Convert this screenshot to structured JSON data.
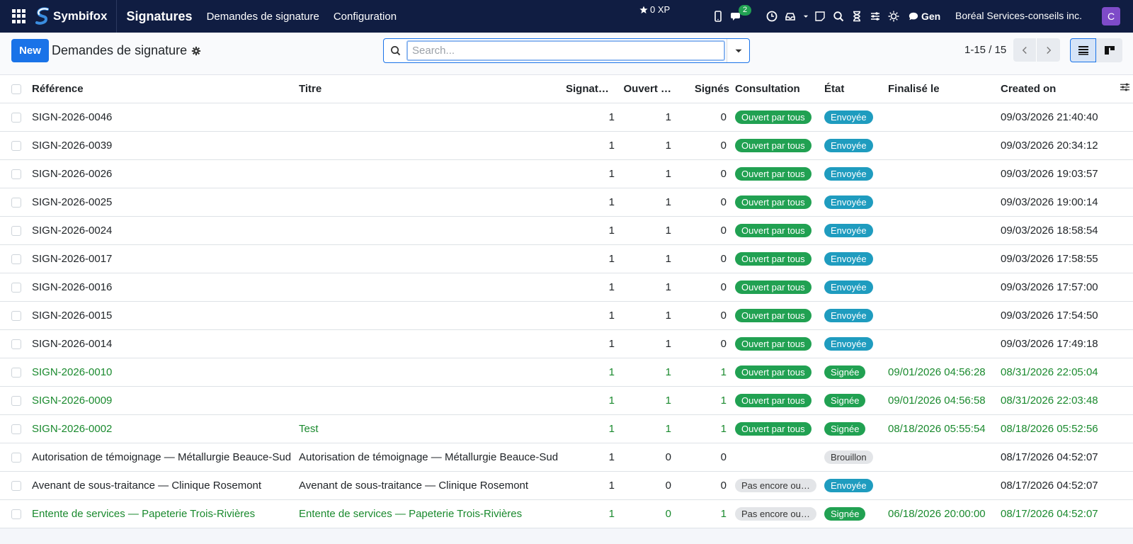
{
  "navbar": {
    "brand": "Symbifox",
    "app_title": "Signatures",
    "menu": [
      "Demandes de signature",
      "Configuration"
    ],
    "xp": "0 XP",
    "messages_count": "2",
    "gen_label": "Gen",
    "company": "Boréal Services-conseils inc.",
    "avatar_letter": "C"
  },
  "control": {
    "new_label": "New",
    "breadcrumb": "Demandes de signature",
    "search_placeholder": "Search...",
    "pager": "1-15 / 15"
  },
  "table": {
    "headers": {
      "reference": "Référence",
      "titre": "Titre",
      "signataires": "Signatai…",
      "ouvert": "Ouvert …",
      "signes": "Signés",
      "consultation": "Consultation",
      "etat": "État",
      "finalise": "Finalisé le",
      "created": "Created on"
    },
    "rows": [
      {
        "ref": "SIGN-2026-0046",
        "titre": "",
        "sig": "1",
        "ouv": "1",
        "signes": "0",
        "consultation": "Ouvert par tous",
        "cons_color": "green",
        "etat": "Envoyée",
        "etat_color": "teal",
        "finalise": "",
        "created": "09/03/2026 21:40:40",
        "done": false
      },
      {
        "ref": "SIGN-2026-0039",
        "titre": "",
        "sig": "1",
        "ouv": "1",
        "signes": "0",
        "consultation": "Ouvert par tous",
        "cons_color": "green",
        "etat": "Envoyée",
        "etat_color": "teal",
        "finalise": "",
        "created": "09/03/2026 20:34:12",
        "done": false
      },
      {
        "ref": "SIGN-2026-0026",
        "titre": "",
        "sig": "1",
        "ouv": "1",
        "signes": "0",
        "consultation": "Ouvert par tous",
        "cons_color": "green",
        "etat": "Envoyée",
        "etat_color": "teal",
        "finalise": "",
        "created": "09/03/2026 19:03:57",
        "done": false
      },
      {
        "ref": "SIGN-2026-0025",
        "titre": "",
        "sig": "1",
        "ouv": "1",
        "signes": "0",
        "consultation": "Ouvert par tous",
        "cons_color": "green",
        "etat": "Envoyée",
        "etat_color": "teal",
        "finalise": "",
        "created": "09/03/2026 19:00:14",
        "done": false
      },
      {
        "ref": "SIGN-2026-0024",
        "titre": "",
        "sig": "1",
        "ouv": "1",
        "signes": "0",
        "consultation": "Ouvert par tous",
        "cons_color": "green",
        "etat": "Envoyée",
        "etat_color": "teal",
        "finalise": "",
        "created": "09/03/2026 18:58:54",
        "done": false
      },
      {
        "ref": "SIGN-2026-0017",
        "titre": "",
        "sig": "1",
        "ouv": "1",
        "signes": "0",
        "consultation": "Ouvert par tous",
        "cons_color": "green",
        "etat": "Envoyée",
        "etat_color": "teal",
        "finalise": "",
        "created": "09/03/2026 17:58:55",
        "done": false
      },
      {
        "ref": "SIGN-2026-0016",
        "titre": "",
        "sig": "1",
        "ouv": "1",
        "signes": "0",
        "consultation": "Ouvert par tous",
        "cons_color": "green",
        "etat": "Envoyée",
        "etat_color": "teal",
        "finalise": "",
        "created": "09/03/2026 17:57:00",
        "done": false
      },
      {
        "ref": "SIGN-2026-0015",
        "titre": "",
        "sig": "1",
        "ouv": "1",
        "signes": "0",
        "consultation": "Ouvert par tous",
        "cons_color": "green",
        "etat": "Envoyée",
        "etat_color": "teal",
        "finalise": "",
        "created": "09/03/2026 17:54:50",
        "done": false
      },
      {
        "ref": "SIGN-2026-0014",
        "titre": "",
        "sig": "1",
        "ouv": "1",
        "signes": "0",
        "consultation": "Ouvert par tous",
        "cons_color": "green",
        "etat": "Envoyée",
        "etat_color": "teal",
        "finalise": "",
        "created": "09/03/2026 17:49:18",
        "done": false
      },
      {
        "ref": "SIGN-2026-0010",
        "titre": "",
        "sig": "1",
        "ouv": "1",
        "signes": "1",
        "consultation": "Ouvert par tous",
        "cons_color": "green",
        "etat": "Signée",
        "etat_color": "green",
        "finalise": "09/01/2026 04:56:28",
        "created": "08/31/2026 22:05:04",
        "done": true
      },
      {
        "ref": "SIGN-2026-0009",
        "titre": "",
        "sig": "1",
        "ouv": "1",
        "signes": "1",
        "consultation": "Ouvert par tous",
        "cons_color": "green",
        "etat": "Signée",
        "etat_color": "green",
        "finalise": "09/01/2026 04:56:58",
        "created": "08/31/2026 22:03:48",
        "done": true
      },
      {
        "ref": "SIGN-2026-0002",
        "titre": "Test",
        "sig": "1",
        "ouv": "1",
        "signes": "1",
        "consultation": "Ouvert par tous",
        "cons_color": "green",
        "etat": "Signée",
        "etat_color": "green",
        "finalise": "08/18/2026 05:55:54",
        "created": "08/18/2026 05:52:56",
        "done": true
      },
      {
        "ref": "Autorisation de témoignage — Métallurgie Beauce-Sud",
        "titre": "Autorisation de témoignage — Métallurgie Beauce-Sud",
        "sig": "1",
        "ouv": "0",
        "signes": "0",
        "consultation": "",
        "cons_color": "",
        "etat": "Brouillon",
        "etat_color": "grey",
        "finalise": "",
        "created": "08/17/2026 04:52:07",
        "done": false
      },
      {
        "ref": "Avenant de sous-traitance — Clinique Rosemont",
        "titre": "Avenant de sous-traitance — Clinique Rosemont",
        "sig": "1",
        "ouv": "0",
        "signes": "0",
        "consultation": "Pas encore ouvert",
        "cons_color": "grey",
        "etat": "Envoyée",
        "etat_color": "teal",
        "finalise": "",
        "created": "08/17/2026 04:52:07",
        "done": false
      },
      {
        "ref": "Entente de services — Papeterie Trois-Rivières",
        "titre": "Entente de services — Papeterie Trois-Rivières",
        "sig": "1",
        "ouv": "0",
        "signes": "1",
        "consultation": "Pas encore ouvert",
        "cons_color": "grey",
        "etat": "Signée",
        "etat_color": "green",
        "finalise": "06/18/2026 20:00:00",
        "created": "08/17/2026 04:52:07",
        "done": true
      }
    ]
  }
}
